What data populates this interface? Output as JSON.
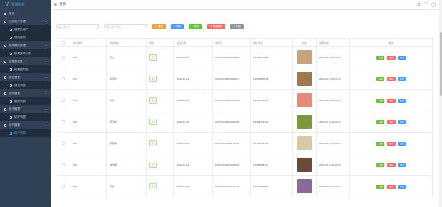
{
  "app": {
    "logo_mark": "V",
    "title": "管理系统"
  },
  "sidebar": {
    "items": [
      {
        "label": "首页",
        "sub": false,
        "active": false
      },
      {
        "label": "系统用户管理",
        "sub": false,
        "active": false,
        "chevron": "▲"
      },
      {
        "label": "管理员用户",
        "sub": true,
        "active": false
      },
      {
        "label": "修改密码",
        "sub": true,
        "active": false
      },
      {
        "label": "新闻模块管理",
        "sub": false,
        "active": false,
        "chevron": "▲"
      },
      {
        "label": "新闻模块列表",
        "sub": true,
        "active": false
      },
      {
        "label": "轮播图设置",
        "sub": false,
        "active": false,
        "chevron": "▲"
      },
      {
        "label": "轮播图列表",
        "sub": true,
        "active": false
      },
      {
        "label": "报告管理",
        "sub": false,
        "active": false,
        "chevron": "▲"
      },
      {
        "label": "报告列表",
        "sub": true,
        "active": false
      },
      {
        "label": "服务管理",
        "sub": false,
        "active": false,
        "chevron": "▲"
      },
      {
        "label": "服务列表",
        "sub": true,
        "active": false
      },
      {
        "label": "帖子管理",
        "sub": false,
        "active": false,
        "chevron": "▲"
      },
      {
        "label": "帖子列表",
        "sub": true,
        "active": false
      },
      {
        "label": "用户管理",
        "sub": false,
        "active": false,
        "chevron": "▲"
      },
      {
        "label": "用户列表",
        "sub": true,
        "active": true
      }
    ]
  },
  "topbar": {
    "hamburger": "≡",
    "breadcrumb": "首页",
    "icons": [
      "↺",
      "⛶"
    ]
  },
  "filters": {
    "username_placeholder": "输入用户名",
    "phone_placeholder": "输入用户手机",
    "buttons": [
      {
        "label": "⊙ 重置",
        "color": "#e6a23c"
      },
      {
        "label": "⌕ 搜索",
        "color": "#409eff"
      },
      {
        "label": "+ 新增",
        "color": "#67c23a"
      },
      {
        "label": "✕ 批量删除",
        "color": "#f56c6c"
      },
      {
        "label": "↓ 导出",
        "color": "#909399"
      }
    ]
  },
  "table": {
    "headers": [
      "用户编号",
      "用户姓名",
      "性别",
      "出生日期",
      "身份证",
      "用户手机",
      "头像",
      "注册时间",
      "操作"
    ],
    "actions": [
      "编辑",
      "删除",
      "详情"
    ],
    "rows": [
      {
        "id": "006",
        "name": "阿达",
        "sex": "男",
        "birth": "2024-03-14",
        "card": "220327198804060022",
        "phone": "13145676588",
        "photo": "#c8a27a",
        "time": "2021-02-11 06:20:12"
      },
      {
        "id": "004",
        "name": "某某长",
        "sex": "男",
        "birth": "2024-03-14",
        "card": "220327198804050011",
        "phone": "13258685548",
        "photo": "#a07850",
        "time": "2021-02-11 06:20:12"
      },
      {
        "id": "003",
        "name": "刘瑶",
        "sex": "男",
        "birth": "2024-01-24",
        "card": "220327199404300399",
        "phone": "13144655855",
        "photo": "#e88a7a",
        "time": "2021-02-11 06:20:12"
      },
      {
        "id": "010",
        "name": "项宇婷",
        "sex": "男",
        "birth": "2024-01-22",
        "card": "220327198801030200",
        "phone": "18358466221",
        "photo": "#7a9a3a",
        "time": "2021-02-11 06:20:12"
      },
      {
        "id": "012",
        "name": "韦晓婷",
        "sex": "男",
        "birth": "2024-03-14",
        "card": "220327199406133460",
        "phone": "13144652352",
        "photo": "#d8c8a8",
        "time": "2021-02-11 06:20:12"
      },
      {
        "id": "000",
        "name": "钟俊超",
        "sex": "男",
        "birth": "2024-03-14",
        "card": "220327199609060083",
        "phone": "13258598711",
        "photo": "#6a4a3a",
        "time": "2021-02-11 06:20:12"
      },
      {
        "id": "015",
        "name": "宋鹏",
        "sex": "男",
        "birth": "2024-03-14",
        "card": "220327198708070789",
        "phone": "13144658654",
        "photo": "#8a6a9a",
        "time": "2021-02-11 06:20:12"
      }
    ]
  }
}
